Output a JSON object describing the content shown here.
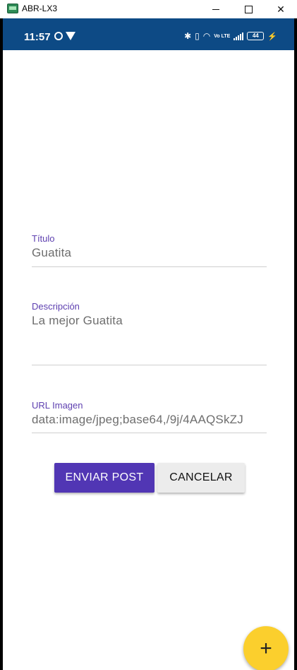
{
  "window": {
    "title": "ABR-LX3",
    "minimize_icon": "minimize-icon",
    "maximize_icon": "maximize-icon",
    "close_glyph": "✕"
  },
  "status_bar": {
    "time": "11:57",
    "battery": "44",
    "network_type": "Vo LTE",
    "background": "#0d4a85"
  },
  "form": {
    "title": {
      "label": "Título",
      "value": "Guatita"
    },
    "description": {
      "label": "Descripción",
      "value": "La mejor Guatita"
    },
    "image_url": {
      "label": "URL Imagen",
      "value": "data:image/jpeg;base64,/9j/4AAQSkZJ"
    }
  },
  "buttons": {
    "submit_label": "ENVIAR POST",
    "cancel_label": "CANCELAR"
  },
  "fab": {
    "icon": "plus-icon",
    "glyph": "+"
  },
  "colors": {
    "accent": "#5136b4",
    "label": "#5e40b0",
    "fab": "#fbcf2d"
  }
}
